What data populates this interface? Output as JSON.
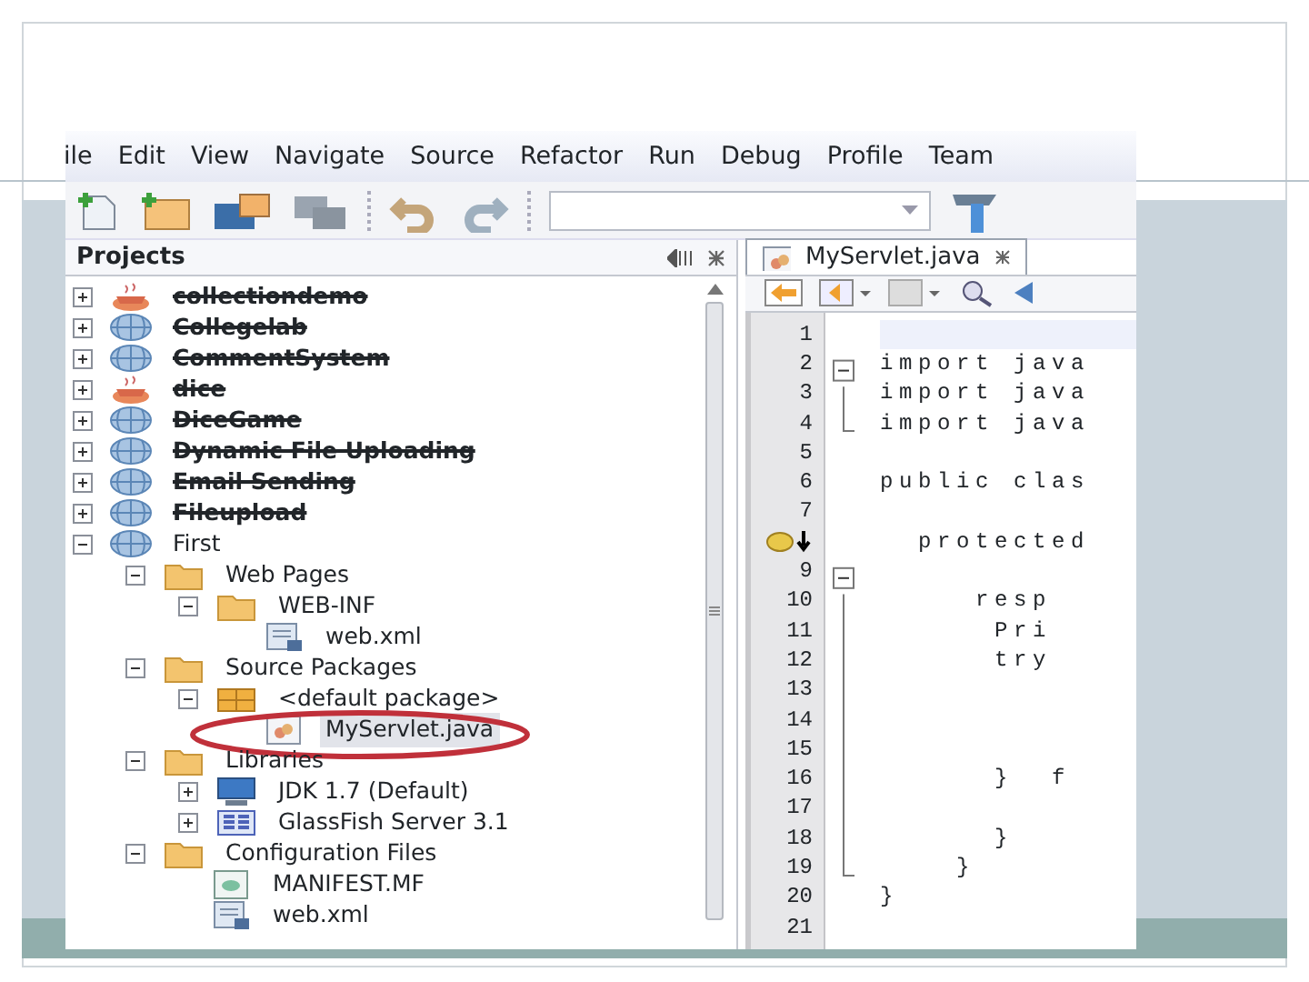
{
  "menu": [
    "ile",
    "Edit",
    "View",
    "Navigate",
    "Source",
    "Refactor",
    "Run",
    "Debug",
    "Profile",
    "Team"
  ],
  "projects_panel": {
    "title": "Projects",
    "tree": [
      {
        "label": "collectiondemo",
        "kind": "java",
        "expanded": false,
        "struck": true,
        "selected": false
      },
      {
        "label": "Collegelab",
        "kind": "web",
        "expanded": false,
        "struck": true,
        "selected": false
      },
      {
        "label": "CommentSystem",
        "kind": "web",
        "expanded": false,
        "struck": true,
        "selected": false
      },
      {
        "label": "dice",
        "kind": "java",
        "expanded": false,
        "struck": true,
        "selected": false
      },
      {
        "label": "DiceGame",
        "kind": "web",
        "expanded": false,
        "struck": true,
        "selected": false
      },
      {
        "label": "Dynamic File Uploading",
        "kind": "web",
        "expanded": false,
        "struck": true,
        "selected": false
      },
      {
        "label": "Email Sending",
        "kind": "web",
        "expanded": false,
        "struck": true,
        "selected": false
      },
      {
        "label": "Fileupload",
        "kind": "web",
        "expanded": false,
        "struck": true,
        "selected": false
      },
      {
        "label": "First",
        "kind": "web",
        "expanded": true,
        "struck": false,
        "selected": false,
        "children": [
          {
            "label": "Web Pages",
            "kind": "folder",
            "expanded": true,
            "struck": false,
            "selected": false,
            "children": [
              {
                "label": "WEB-INF",
                "kind": "folder",
                "expanded": true,
                "struck": false,
                "selected": false,
                "children": [
                  {
                    "label": "web.xml",
                    "kind": "xml",
                    "struck": false,
                    "selected": false
                  }
                ]
              }
            ]
          },
          {
            "label": "Source Packages",
            "kind": "folder",
            "expanded": true,
            "struck": false,
            "selected": false,
            "children": [
              {
                "label": "<default package>",
                "kind": "package",
                "expanded": true,
                "struck": false,
                "selected": false,
                "children": [
                  {
                    "label": "MyServlet.java",
                    "kind": "servlet",
                    "struck": false,
                    "selected": true,
                    "circled": true
                  }
                ]
              }
            ]
          },
          {
            "label": "Libraries",
            "kind": "folder",
            "expanded": true,
            "struck": false,
            "selected": false,
            "children": [
              {
                "label": "JDK 1.7 (Default)",
                "kind": "jdk",
                "expanded": false,
                "struck": false,
                "selected": false
              },
              {
                "label": "GlassFish Server 3.1",
                "kind": "server",
                "expanded": false,
                "struck": false,
                "selected": false
              }
            ]
          },
          {
            "label": "Configuration Files",
            "kind": "folder",
            "expanded": true,
            "struck": false,
            "selected": false,
            "children": [
              {
                "label": "MANIFEST.MF",
                "kind": "manifest",
                "struck": false,
                "selected": false
              },
              {
                "label": "web.xml",
                "kind": "xml",
                "struck": false,
                "selected": false
              }
            ]
          }
        ]
      }
    ]
  },
  "editor": {
    "tab": "MyServlet.java",
    "lines": [
      {
        "num": "1"
      },
      {
        "num": "2",
        "code": "import java"
      },
      {
        "num": "3",
        "code": "import java"
      },
      {
        "num": "4",
        "code": "import java"
      },
      {
        "num": "5"
      },
      {
        "num": "6",
        "code": "public clas"
      },
      {
        "num": "7"
      },
      {
        "kind": "marker",
        "code": "  protected"
      },
      {
        "num": "9"
      },
      {
        "num": "10",
        "code": "     resp"
      },
      {
        "num": "11",
        "code": "      Pri"
      },
      {
        "num": "12",
        "code": "      try"
      },
      {
        "num": "13"
      },
      {
        "num": "14"
      },
      {
        "num": "15"
      },
      {
        "num": "16",
        "code": "      }  f"
      },
      {
        "num": "17"
      },
      {
        "num": "18",
        "code": "      }"
      },
      {
        "num": "19",
        "code": "    }"
      },
      {
        "num": "20",
        "code": "}"
      },
      {
        "num": "21"
      }
    ]
  }
}
